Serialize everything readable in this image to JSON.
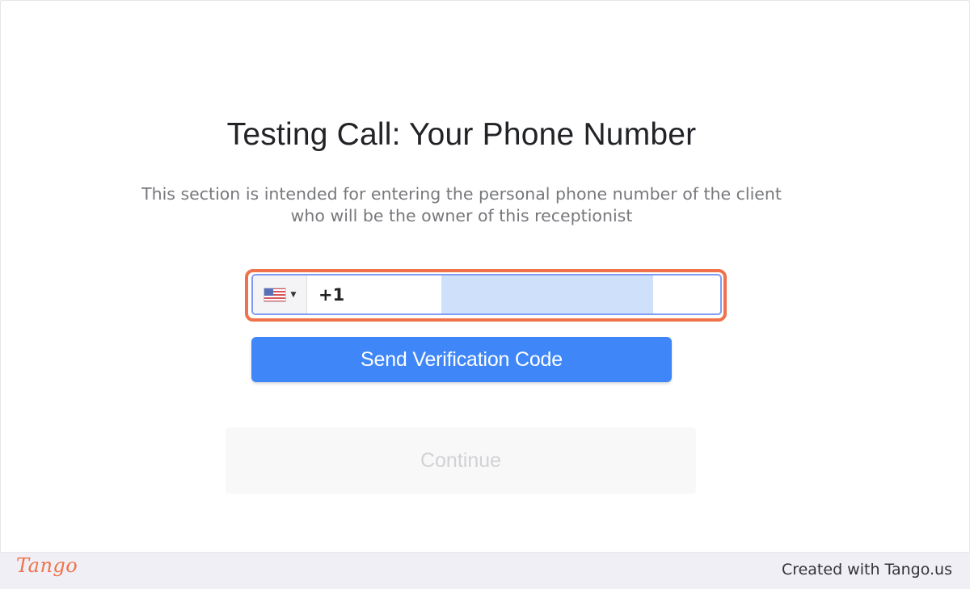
{
  "page": {
    "title": "Testing Call: Your Phone Number",
    "description_line1": "This section is intended for entering the personal phone number of the client",
    "description_line2": "who will be the owner of this receptionist"
  },
  "phone_field": {
    "country": "US",
    "country_flag_icon": "us-flag-icon",
    "dial_code": "+1",
    "value": "",
    "highlight_color": "#f0724a",
    "border_color": "#7f9cf2"
  },
  "buttons": {
    "send_verification_label": "Send Verification Code",
    "continue_label": "Continue",
    "accent_color": "#3f87f8"
  },
  "footer": {
    "brand_logo": "Tango",
    "created_with": "Created with Tango.us"
  }
}
